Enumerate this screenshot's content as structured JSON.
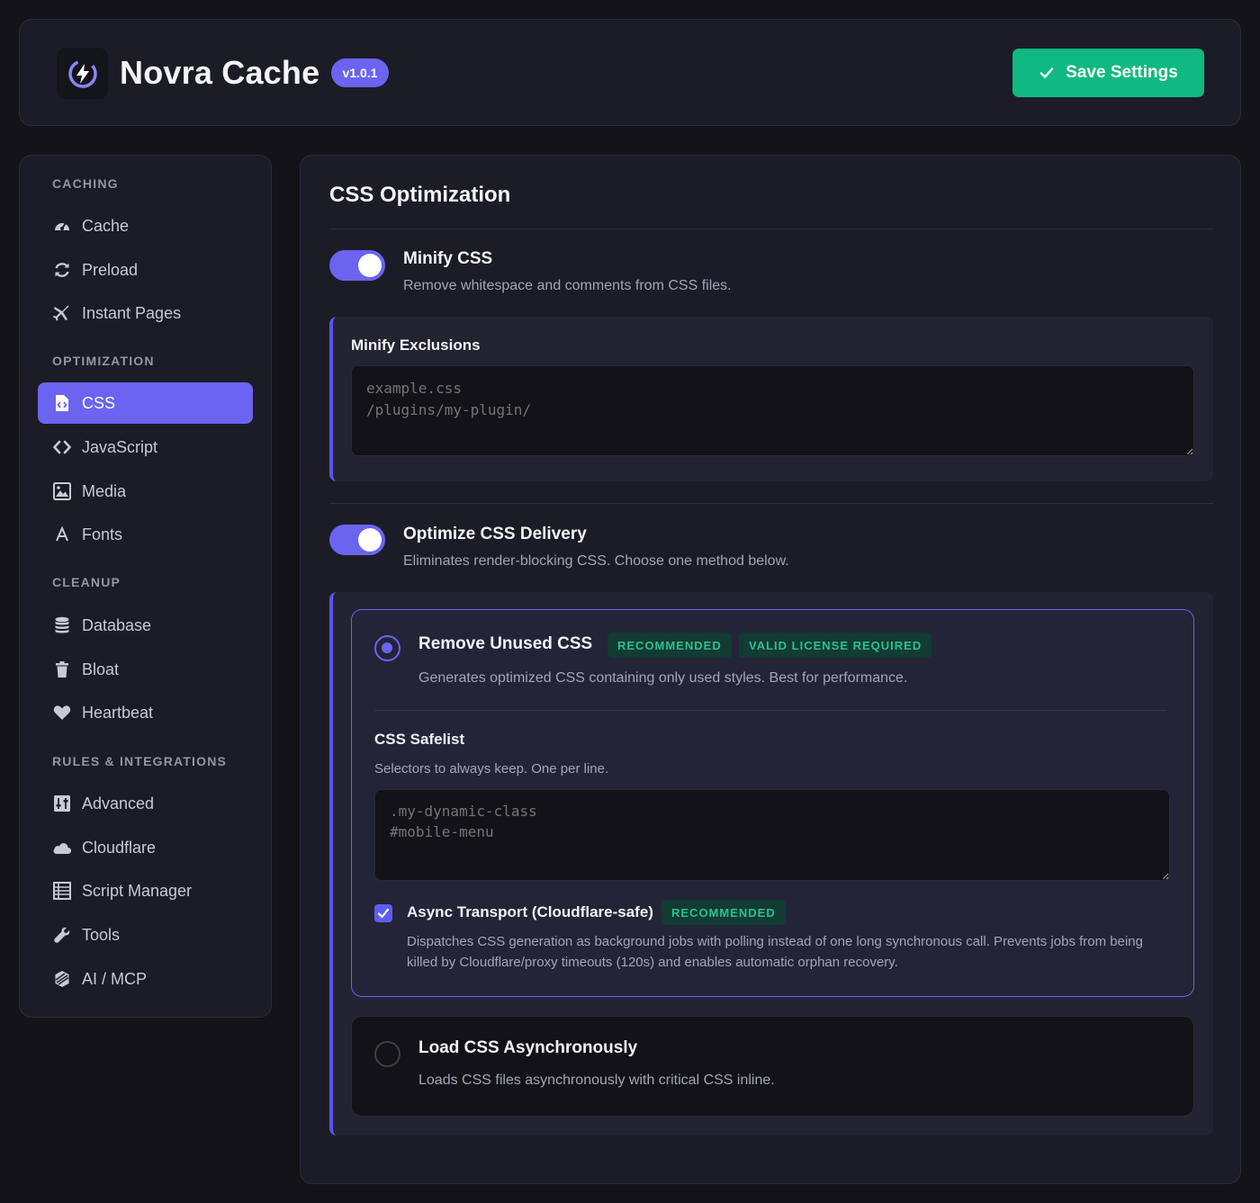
{
  "app": {
    "title": "Novra Cache",
    "version": "v1.0.1",
    "save_label": "Save Settings",
    "colors": {
      "accent": "#6a64f1",
      "save": "#10b981",
      "badge_text": "#29c28a"
    }
  },
  "sidebar": {
    "sections": [
      {
        "label": "CACHING",
        "items": [
          {
            "label": "Cache",
            "icon": "gauge-icon"
          },
          {
            "label": "Preload",
            "icon": "sync-icon"
          },
          {
            "label": "Instant Pages",
            "icon": "plane-icon"
          }
        ]
      },
      {
        "label": "OPTIMIZATION",
        "items": [
          {
            "label": "CSS",
            "icon": "css-file-icon",
            "active": true
          },
          {
            "label": "JavaScript",
            "icon": "code-icon"
          },
          {
            "label": "Media",
            "icon": "image-icon"
          },
          {
            "label": "Fonts",
            "icon": "font-icon"
          }
        ]
      },
      {
        "label": "CLEANUP",
        "items": [
          {
            "label": "Database",
            "icon": "database-icon"
          },
          {
            "label": "Bloat",
            "icon": "trash-icon"
          },
          {
            "label": "Heartbeat",
            "icon": "heart-icon"
          }
        ]
      },
      {
        "label": "RULES & INTEGRATIONS",
        "items": [
          {
            "label": "Advanced",
            "icon": "sliders-icon"
          },
          {
            "label": "Cloudflare",
            "icon": "cloud-icon"
          },
          {
            "label": "Script Manager",
            "icon": "list-icon"
          },
          {
            "label": "Tools",
            "icon": "wrench-icon"
          },
          {
            "label": "AI / MCP",
            "icon": "ai-icon"
          }
        ]
      }
    ]
  },
  "main": {
    "title": "CSS Optimization",
    "minify": {
      "title": "Minify CSS",
      "desc": "Remove whitespace and comments from CSS files.",
      "enabled": true,
      "exclusions_label": "Minify Exclusions",
      "exclusions_placeholder": "example.css\n/plugins/my-plugin/"
    },
    "delivery": {
      "title": "Optimize CSS Delivery",
      "desc": "Eliminates render-blocking CSS. Choose one method below.",
      "enabled": true,
      "remove_unused": {
        "title": "Remove Unused CSS",
        "badge_recommended": "RECOMMENDED",
        "badge_license": "VALID LICENSE REQUIRED",
        "desc": "Generates optimized CSS containing only used styles. Best for performance.",
        "selected": true,
        "safelist_label": "CSS Safelist",
        "safelist_help": "Selectors to always keep. One per line.",
        "safelist_placeholder": ".my-dynamic-class\n#mobile-menu",
        "async_label": "Async Transport (Cloudflare-safe)",
        "async_badge": "RECOMMENDED",
        "async_checked": true,
        "async_desc": "Dispatches CSS generation as background jobs with polling instead of one long synchronous call. Prevents jobs from being killed by Cloudflare/proxy timeouts (120s) and enables automatic orphan recovery."
      },
      "load_async": {
        "title": "Load CSS Asynchronously",
        "desc": "Loads CSS files asynchronously with critical CSS inline.",
        "selected": false
      }
    }
  }
}
